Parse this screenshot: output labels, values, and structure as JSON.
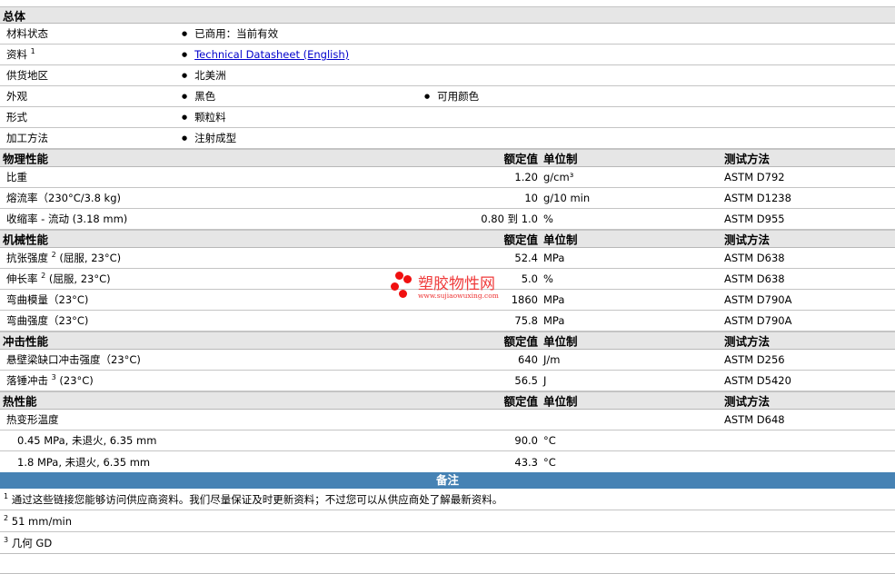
{
  "general": {
    "title": "总体",
    "rows": [
      {
        "label": "材料状态",
        "v1": "已商用：当前有效"
      },
      {
        "label": "资料",
        "sup": "1",
        "link": "Technical Datasheet (English)"
      },
      {
        "label": "供货地区",
        "v1": "北美洲"
      },
      {
        "label": "外观",
        "v1": "黑色",
        "v2": "可用颜色"
      },
      {
        "label": "形式",
        "v1": "颗粒料"
      },
      {
        "label": "加工方法",
        "v1": "注射成型"
      }
    ]
  },
  "col_headers": {
    "value": "额定值",
    "unit": "单位制",
    "test": "测试方法"
  },
  "physical": {
    "title": "物理性能",
    "rows": [
      {
        "label": "比重",
        "value": "1.20",
        "unit": "g/cm³",
        "test": "ASTM D792"
      },
      {
        "label": "熔流率（230°C/3.8 kg)",
        "value": "10",
        "unit": "g/10 min",
        "test": "ASTM D1238"
      },
      {
        "label": "收缩率 - 流动 (3.18 mm)",
        "value": "0.80 到 1.0",
        "unit": "%",
        "test": "ASTM D955"
      }
    ]
  },
  "mechanical": {
    "title": "机械性能",
    "rows": [
      {
        "label": "抗张强度",
        "sup": "2",
        "label2": "(屈服, 23°C)",
        "value": "52.4",
        "unit": "MPa",
        "test": "ASTM D638"
      },
      {
        "label": "伸长率",
        "sup": "2",
        "label2": "(屈服, 23°C)",
        "value": "5.0",
        "unit": "%",
        "test": "ASTM D638"
      },
      {
        "label": "弯曲模量（23°C)",
        "value": "1860",
        "unit": "MPa",
        "test": "ASTM D790A"
      },
      {
        "label": "弯曲强度（23°C)",
        "value": "75.8",
        "unit": "MPa",
        "test": "ASTM D790A"
      }
    ]
  },
  "impact": {
    "title": "冲击性能",
    "rows": [
      {
        "label": "悬壁梁缺口冲击强度（23°C)",
        "value": "640",
        "unit": "J/m",
        "test": "ASTM D256"
      },
      {
        "label": "落锤冲击",
        "sup": "3",
        "label2": "(23°C)",
        "value": "56.5",
        "unit": "J",
        "test": "ASTM D5420"
      }
    ]
  },
  "thermal": {
    "title": "热性能",
    "rows": [
      {
        "label": "热变形温度",
        "test": "ASTM D648"
      },
      {
        "label": "0.45 MPa, 未退火, 6.35 mm",
        "value": "90.0",
        "unit": "°C"
      },
      {
        "label": "1.8 MPa, 未退火, 6.35 mm",
        "value": "43.3",
        "unit": "°C"
      }
    ]
  },
  "notes": {
    "title": "备注",
    "items": [
      {
        "sup": "1",
        "text": "通过这些链接您能够访问供应商资料。我们尽量保证及时更新资料；不过您可以从供应商处了解最新资料。"
      },
      {
        "sup": "2",
        "text": "51 mm/min"
      },
      {
        "sup": "3",
        "text": "几何  GD"
      }
    ]
  },
  "watermark": {
    "name": "塑胶物性网",
    "url": "www.sujiaowuxing.com"
  }
}
